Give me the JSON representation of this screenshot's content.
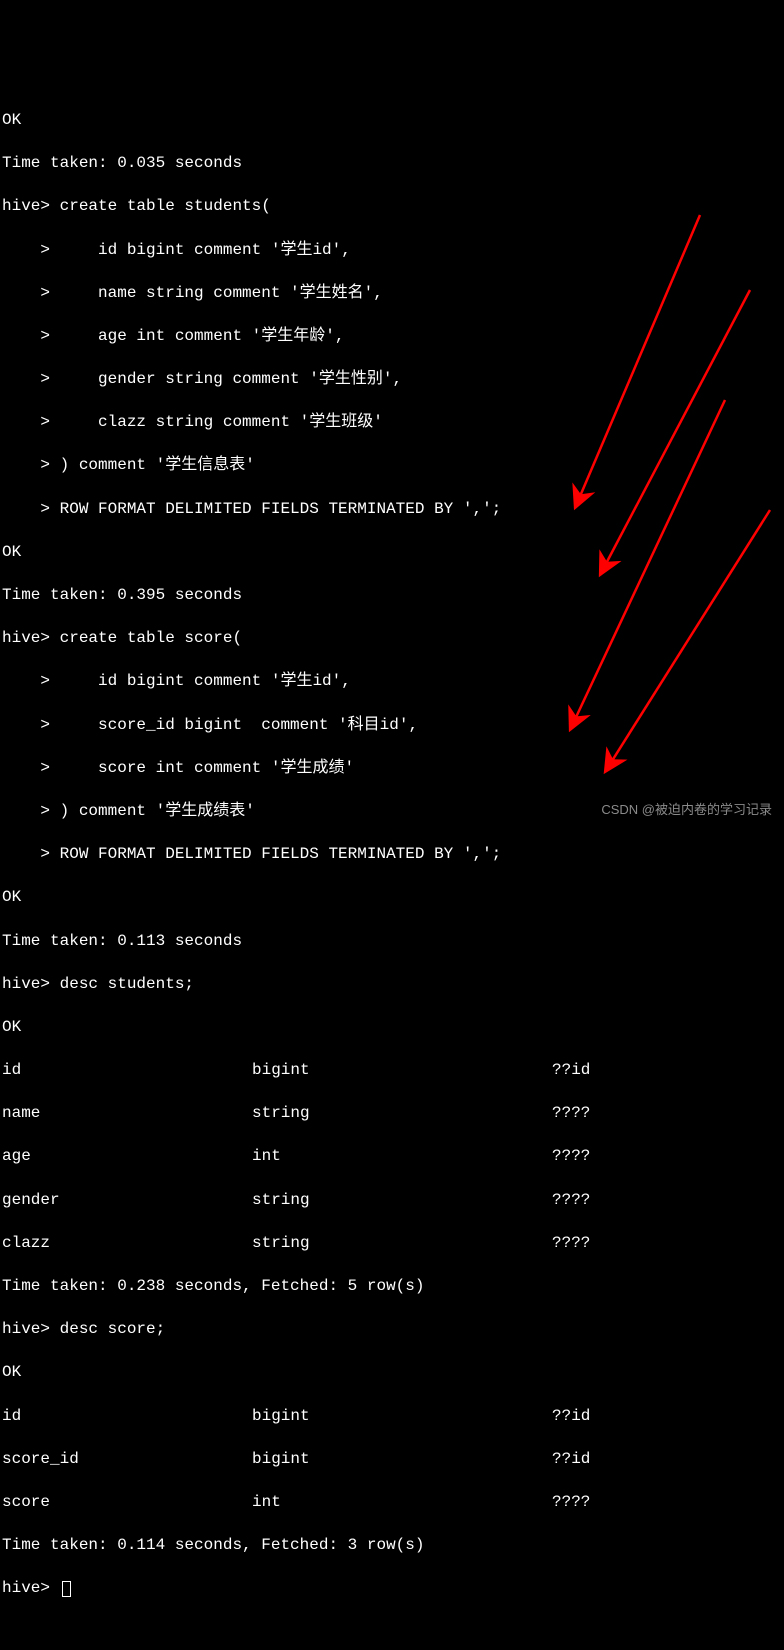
{
  "block1": {
    "ok": "OK",
    "time": "Time taken: 0.035 seconds",
    "prompt": "hive> ",
    "cmd_start": "create table students(",
    "cont": "    > ",
    "l1": "    id bigint comment '学生id',",
    "l2": "    name string comment '学生姓名',",
    "l3": "    age int comment '学生年龄',",
    "l4": "    gender string comment '学生性别',",
    "l5": "    clazz string comment '学生班级'",
    "l6": ") comment '学生信息表'",
    "l7": "ROW FORMAT DELIMITED FIELDS TERMINATED BY ',';"
  },
  "block2": {
    "ok": "OK",
    "time": "Time taken: 0.395 seconds",
    "cmd_start": "create table score(",
    "l1": "    id bigint comment '学生id',",
    "l2": "    score_id bigint  comment '科目id',",
    "l3": "    score int comment '学生成绩'",
    "l4": ") comment '学生成绩表'",
    "l5": "ROW FORMAT DELIMITED FIELDS TERMINATED BY ',';"
  },
  "block3": {
    "ok": "OK",
    "time": "Time taken: 0.113 seconds",
    "cmd": "desc students;"
  },
  "desc_students": {
    "ok": "OK",
    "rows": [
      {
        "name": "id",
        "type": "bigint",
        "comment": "??id"
      },
      {
        "name": "name",
        "type": "string",
        "comment": "????"
      },
      {
        "name": "age",
        "type": "int",
        "comment": "????"
      },
      {
        "name": "gender",
        "type": "string",
        "comment": "????"
      },
      {
        "name": "clazz",
        "type": "string",
        "comment": "????"
      }
    ],
    "time": "Time taken: 0.238 seconds, Fetched: 5 row(s)"
  },
  "block4": {
    "cmd": "desc score;"
  },
  "desc_score": {
    "ok": "OK",
    "rows": [
      {
        "name": "id",
        "type": "bigint",
        "comment": "??id"
      },
      {
        "name": "score_id",
        "type": "bigint",
        "comment": "??id"
      },
      {
        "name": "score",
        "type": "int",
        "comment": "????"
      }
    ],
    "time": "Time taken: 0.114 seconds, Fetched: 3 row(s)"
  },
  "final_prompt": "hive> ",
  "watermark": "CSDN @被迫内卷的学习记录",
  "arrow_color": "#ff0000"
}
